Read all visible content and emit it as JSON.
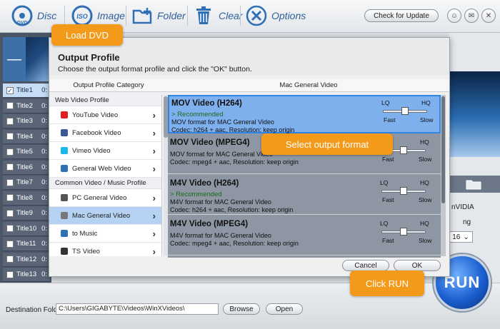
{
  "toolbar": {
    "disc": "Disc",
    "disc_icon_text": "DVD",
    "image": "Image",
    "image_icon_text": "ISO",
    "folder": "Folder",
    "clear": "Clear",
    "options": "Options",
    "check_update": "Check for Update"
  },
  "titles": [
    "Title1",
    "Title2",
    "Title3",
    "Title4",
    "Title5",
    "Title6",
    "Title7",
    "Title8",
    "Title9",
    "Title10",
    "Title11",
    "Title12",
    "Title13"
  ],
  "title_suffix": "0:",
  "dialog": {
    "title": "Output Profile",
    "subtitle": "Choose the output format profile and click the \"OK\" button.",
    "category_header": "Output Profile Category",
    "format_header": "Mac General Video",
    "groups": [
      {
        "label": "Web Video Profile",
        "items": [
          "YouTube Video",
          "Facebook Video",
          "Vimeo Video",
          "General Web Video"
        ]
      },
      {
        "label": "Common Video / Music Profile",
        "items": [
          "PC General Video",
          "Mac General Video",
          "to Music",
          "TS Video"
        ]
      }
    ],
    "selected_category": "Mac General Video",
    "formats": [
      {
        "name": "MOV Video (H264)",
        "recommended": "> Recommended",
        "desc": "MOV format for MAC General Video",
        "codec": "Codec: h264 + aac, Resolution: keep origin"
      },
      {
        "name": "MOV Video (MPEG4)",
        "recommended": "",
        "desc": "MOV format for MAC General Video",
        "codec": "Codec: mpeg4 + aac, Resolution: keep origin"
      },
      {
        "name": "M4V Video (H264)",
        "recommended": "> Recommended",
        "desc": "M4V format for MAC General Video",
        "codec": "Codec: h264 + aac, Resolution: keep origin"
      },
      {
        "name": "M4V Video (MPEG4)",
        "recommended": "",
        "desc": "M4V format for MAC General Video",
        "codec": "Codec: mpeg4 + aac, Resolution: keep origin"
      }
    ],
    "quality": {
      "lq": "LQ",
      "hq": "HQ",
      "fast": "Fast",
      "slow": "Slow"
    },
    "cancel": "Cancel",
    "ok": "OK"
  },
  "right_panel": {
    "nvidia": "nVIDIA",
    "label": "ng",
    "select_value": "16"
  },
  "run": "RUN",
  "bottom": {
    "dest_label": "Destination Folder:",
    "dest_value": "C:\\Users\\GIGABYTE\\Videos\\WinXVideos\\",
    "browse": "Browse",
    "open": "Open"
  },
  "callouts": {
    "load_dvd": "Load DVD",
    "select_format": "Select output format",
    "click_run": "Click RUN"
  },
  "colors": {
    "accent_blue": "#2f86e6",
    "callout_orange": "#f39a1a",
    "recommended_green": "#1a6a1a"
  }
}
